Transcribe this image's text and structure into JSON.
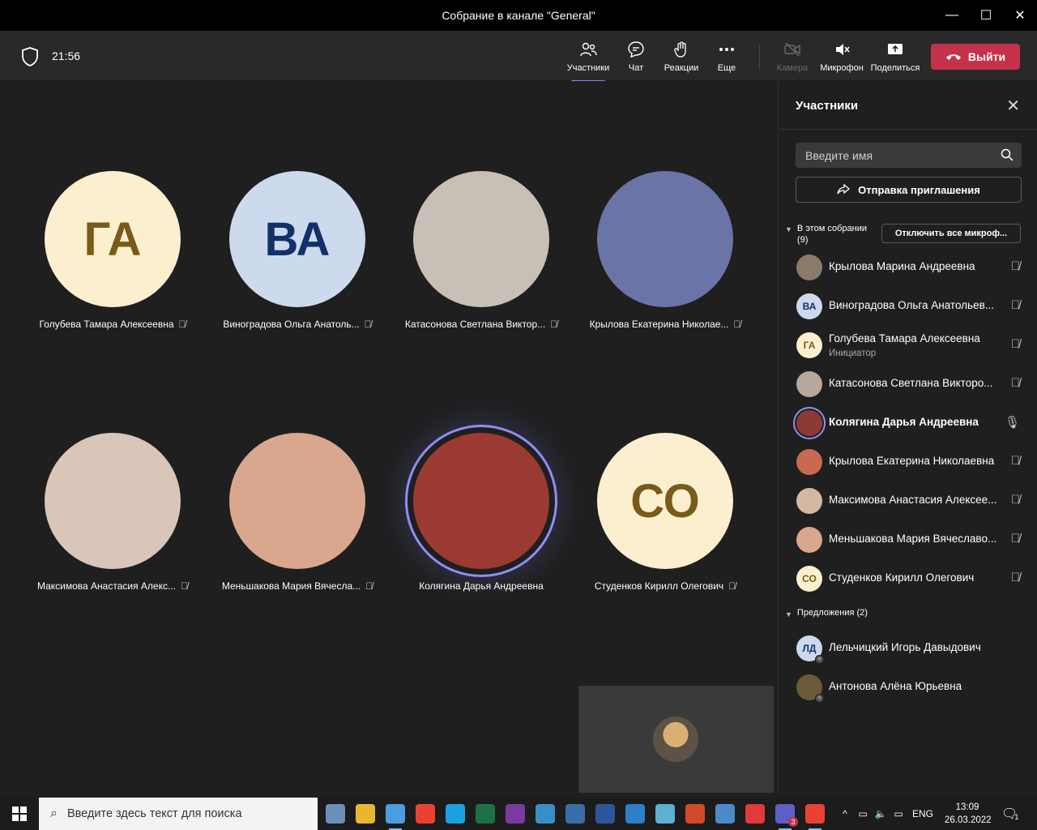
{
  "window": {
    "title": "Собрание в канале \"General\"",
    "minimize": "—",
    "maximize": "☐",
    "close": "✕"
  },
  "toolbar": {
    "timer": "21:56",
    "participants_label": "Участники",
    "chat_label": "Чат",
    "reactions_label": "Реакции",
    "more_label": "Еще",
    "camera_label": "Камера",
    "mic_label": "Микрофон",
    "share_label": "Поделиться",
    "leave_label": "Выйти"
  },
  "tiles": [
    {
      "name": "Голубева Тамара Алексеевна",
      "initials": "ГА",
      "bg": "#fcefd0",
      "fg": "#7a5a18",
      "muted": true
    },
    {
      "name": "Виноградова Ольга Анатоль...",
      "initials": "ВА",
      "bg": "#cdd9ec",
      "fg": "#12306a",
      "muted": true
    },
    {
      "name": "Катасонова Светлана Виктор...",
      "initials": "",
      "bg": "#c8c0b6",
      "fg": "#000",
      "muted": true
    },
    {
      "name": "Крылова Екатерина Николае...",
      "initials": "",
      "bg": "#6a74a6",
      "fg": "#000",
      "muted": true
    },
    {
      "name": "Максимова Анастасия Алекс...",
      "initials": "",
      "bg": "#d9c6b8",
      "fg": "#000",
      "muted": true
    },
    {
      "name": "Меньшакова Мария Вячесла...",
      "initials": "",
      "bg": "#d8a78e",
      "fg": "#000",
      "muted": true
    },
    {
      "name": "Колягина Дарья Андреевна",
      "initials": "",
      "bg": "#9b3a33",
      "fg": "#000",
      "muted": false
    },
    {
      "name": "Студенков Кирилл Олегович",
      "initials": "СО",
      "bg": "#fcefd0",
      "fg": "#7a5a18",
      "muted": true
    }
  ],
  "panel": {
    "title": "Участники",
    "search_placeholder": "Введите имя",
    "invite_label": "Отправка приглашения",
    "in_meeting_label": "В этом собрании",
    "in_meeting_count": "(9)",
    "mute_all_label": "Отключить все микроф...",
    "suggestions_label": "Предложения (2)",
    "members": [
      {
        "name": "Крылова Марина Андреевна",
        "initials": "",
        "bg": "#8a7a6a",
        "fg": "#000",
        "role": "",
        "muted": true,
        "speaking": false
      },
      {
        "name": "Виноградова Ольга Анатольев...",
        "initials": "ВА",
        "bg": "#cdd9ec",
        "fg": "#12306a",
        "role": "",
        "muted": true,
        "speaking": false
      },
      {
        "name": "Голубева Тамара Алексеевна",
        "initials": "ГА",
        "bg": "#fcefd0",
        "fg": "#7a5a18",
        "role": "Инициатор",
        "muted": true,
        "speaking": false
      },
      {
        "name": "Катасонова Светлана Викторо...",
        "initials": "",
        "bg": "#b9a79a",
        "fg": "#000",
        "role": "",
        "muted": true,
        "speaking": false
      },
      {
        "name": "Колягина Дарья Андреевна",
        "initials": "",
        "bg": "#8c3a34",
        "fg": "#000",
        "role": "",
        "muted": false,
        "speaking": true
      },
      {
        "name": "Крылова Екатерина Николаевна",
        "initials": "",
        "bg": "#c86a50",
        "fg": "#000",
        "role": "",
        "muted": true,
        "speaking": false
      },
      {
        "name": "Максимова Анастасия Алексее...",
        "initials": "",
        "bg": "#d4b8a4",
        "fg": "#000",
        "role": "",
        "muted": true,
        "speaking": false
      },
      {
        "name": "Меньшакова Мария Вячеславо...",
        "initials": "",
        "bg": "#d8a78e",
        "fg": "#000",
        "role": "",
        "muted": true,
        "speaking": false
      },
      {
        "name": "Студенков Кирилл Олегович",
        "initials": "СО",
        "bg": "#fcefd0",
        "fg": "#7a5a18",
        "role": "",
        "muted": true,
        "speaking": false
      }
    ],
    "suggestions": [
      {
        "name": "Лельчицкий Игорь Давыдович",
        "initials": "ЛД",
        "bg": "#cdd9ec",
        "fg": "#12306a"
      },
      {
        "name": "Антонова Алёна Юрьевна",
        "initials": "",
        "bg": "#6a5a3a",
        "fg": "#000"
      }
    ]
  },
  "taskbar": {
    "search_placeholder": "Введите здесь текст для поиска",
    "lang": "ENG",
    "time": "13:09",
    "date": "26.03.2022",
    "notifications": "1",
    "teams_badge": "3",
    "apps": [
      "task-view",
      "file-explorer",
      "paint",
      "chrome",
      "edge",
      "excel",
      "winrar",
      "image-viewer",
      "screenshot-tool",
      "word",
      "eye-app",
      "notes-app",
      "ieee-app",
      "download-app",
      "recorder-app",
      "teams",
      "chrome-profile"
    ]
  },
  "colors": {
    "accent": "#7f85f5",
    "leave": "#c4314b",
    "toolbar": "#292929",
    "stage": "#1f1f1f"
  }
}
